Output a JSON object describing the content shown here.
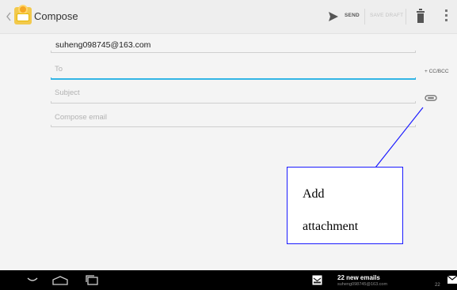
{
  "actionbar": {
    "title": "Compose",
    "send_label": "SEND",
    "save_draft_label": "SAVE DRAFT",
    "icons": [
      "back-chevron-icon",
      "email-app-icon",
      "send-icon",
      "trash-icon",
      "overflow-menu-icon"
    ]
  },
  "form": {
    "from": "suheng098745@163.com",
    "to_placeholder": "To",
    "subject_placeholder": "Subject",
    "body_placeholder": "Compose email",
    "cc_bcc": "+ CC/BCC"
  },
  "callout": {
    "line1": "Add",
    "line2": "attachment",
    "border_color": "#1a1aff"
  },
  "statusbar": {
    "notification_title": "22 new emails",
    "notification_sub": "suheng098745@163.com",
    "notification_count": "22",
    "icons": [
      "nav-back-icon",
      "nav-home-icon",
      "nav-recent-apps-icon",
      "email-notification-icon",
      "mail-status-icon"
    ]
  },
  "colors": {
    "accent": "#33b5e5",
    "actionbar_bg": "#eeeeee",
    "navbar_bg": "#000000"
  }
}
